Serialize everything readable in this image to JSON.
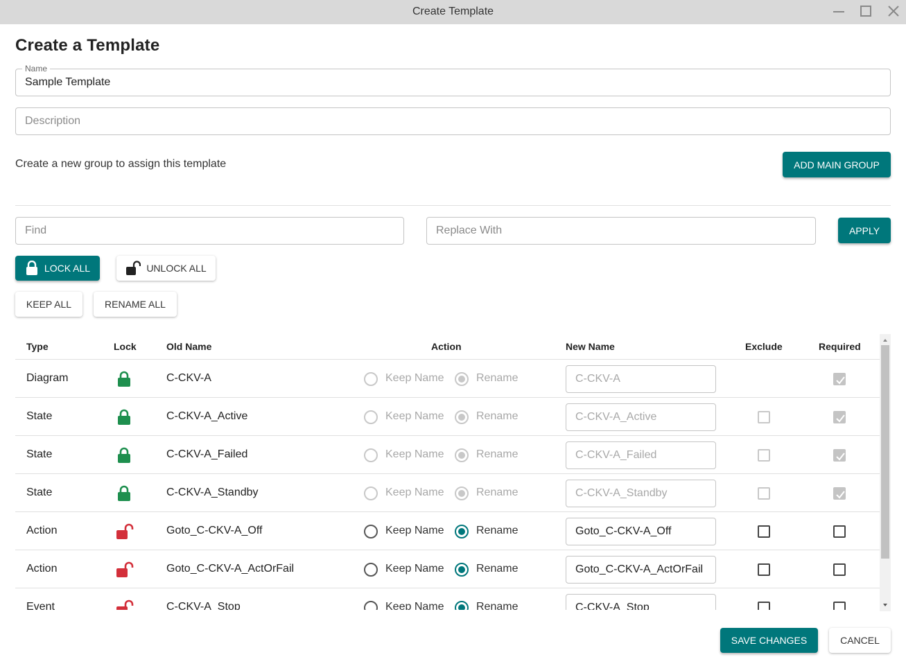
{
  "window": {
    "title": "Create Template"
  },
  "heading": "Create a Template",
  "name_field": {
    "label": "Name",
    "value": "Sample Template"
  },
  "description_field": {
    "placeholder": "Description"
  },
  "group_hint": "Create a new group to assign this template",
  "add_main_group_label": "ADD MAIN GROUP",
  "find_field": {
    "placeholder": "Find"
  },
  "replace_field": {
    "placeholder": "Replace With"
  },
  "apply_label": "APPLY",
  "lock_all_label": "LOCK ALL",
  "unlock_all_label": "UNLOCK ALL",
  "keep_all_label": "KEEP ALL",
  "rename_all_label": "RENAME ALL",
  "table": {
    "headers": {
      "type": "Type",
      "lock": "Lock",
      "old_name": "Old Name",
      "action": "Action",
      "new_name": "New Name",
      "exclude": "Exclude",
      "required": "Required"
    },
    "keep_label": "Keep Name",
    "rename_label": "Rename",
    "rows": [
      {
        "type": "Diagram",
        "locked": true,
        "old_name": "C-CKV-A",
        "action": "Rename",
        "new_name": "C-CKV-A",
        "exclude": null,
        "required": true
      },
      {
        "type": "State",
        "locked": true,
        "old_name": "C-CKV-A_Active",
        "action": "Rename",
        "new_name": "C-CKV-A_Active",
        "exclude": false,
        "required": true
      },
      {
        "type": "State",
        "locked": true,
        "old_name": "C-CKV-A_Failed",
        "action": "Rename",
        "new_name": "C-CKV-A_Failed",
        "exclude": false,
        "required": true
      },
      {
        "type": "State",
        "locked": true,
        "old_name": "C-CKV-A_Standby",
        "action": "Rename",
        "new_name": "C-CKV-A_Standby",
        "exclude": false,
        "required": true
      },
      {
        "type": "Action",
        "locked": false,
        "old_name": "Goto_C-CKV-A_Off",
        "action": "Rename",
        "new_name": "Goto_C-CKV-A_Off",
        "exclude": false,
        "required": false
      },
      {
        "type": "Action",
        "locked": false,
        "old_name": "Goto_C-CKV-A_ActOrFail",
        "action": "Rename",
        "new_name": "Goto_C-CKV-A_ActOrFail",
        "exclude": false,
        "required": false
      },
      {
        "type": "Event",
        "locked": false,
        "old_name": "C-CKV-A_Stop",
        "action": "Rename",
        "new_name": "C-CKV-A_Stop",
        "exclude": false,
        "required": false
      }
    ]
  },
  "save_label": "SAVE CHANGES",
  "cancel_label": "CANCEL",
  "colors": {
    "accent": "#00777b",
    "locked": "#1e8f4e",
    "unlocked": "#d32f3a"
  },
  "icons": {
    "lock_all": "lock-icon",
    "unlock_all": "unlock-icon",
    "row_locked": "lock-icon",
    "row_unlocked": "unlock-icon"
  }
}
